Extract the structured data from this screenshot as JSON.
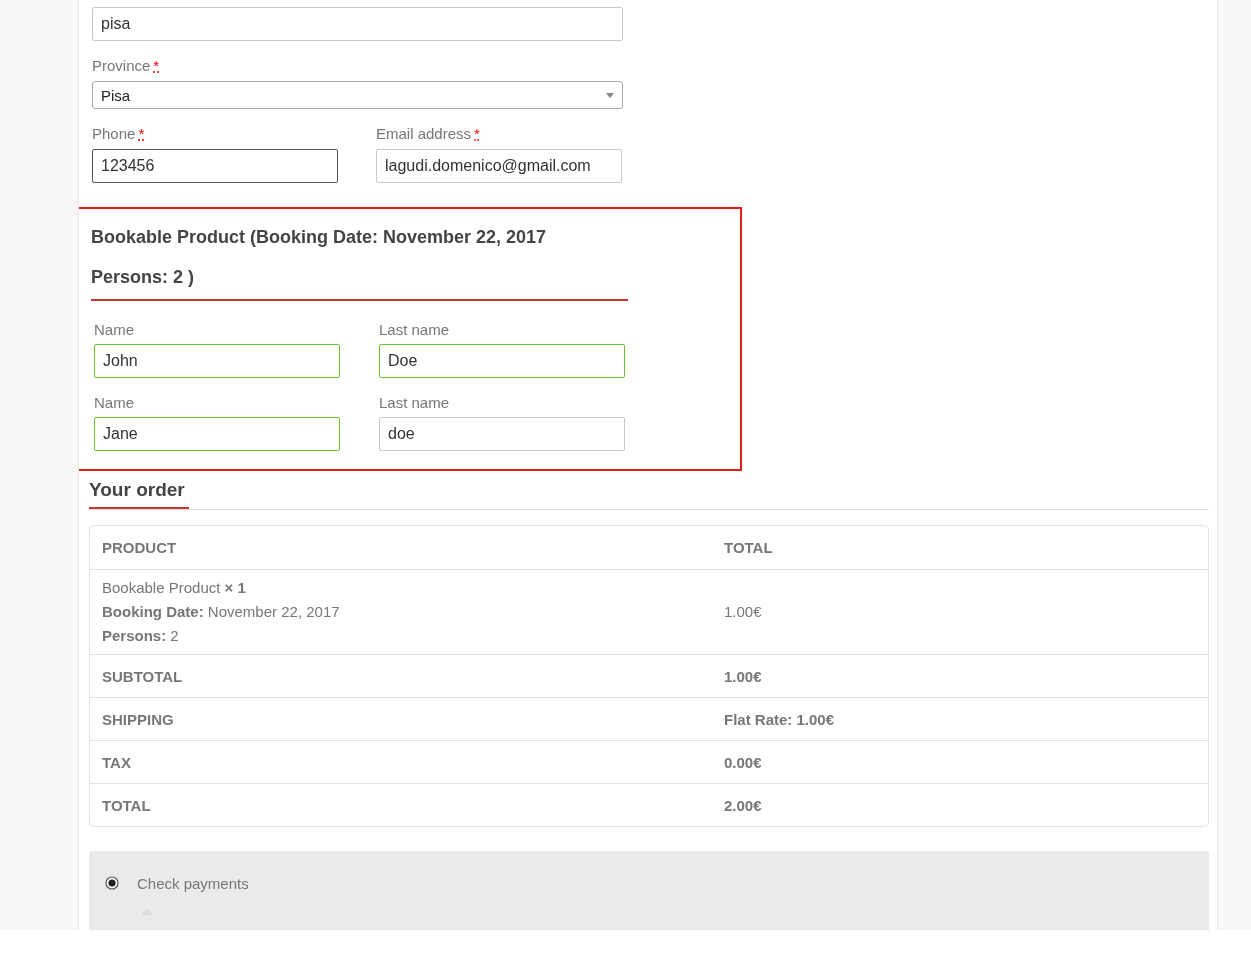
{
  "address_fields": [
    [
      {
        "kind": "text",
        "value": "pisa",
        "focused": false
      }
    ],
    [
      {
        "kind": "select",
        "label": {
          "text": "Province",
          "required_mark": "*"
        },
        "value": "Pisa"
      }
    ],
    [
      {
        "kind": "text",
        "label": {
          "text": "Phone",
          "required_mark": "*"
        },
        "value": "123456",
        "focused": true
      },
      {
        "kind": "text",
        "label": {
          "text": "Email address",
          "required_mark": "*"
        },
        "value": "lagudi.domenico@gmail.com",
        "focused": false
      }
    ]
  ],
  "participants": {
    "highlighted": true,
    "heading": "Bookable Product (Booking Date: November 22, 2017 Persons: 2 )",
    "fields": [
      {
        "label": "Name",
        "value": "John",
        "valid": true
      },
      {
        "label": "Last name",
        "value": "Doe",
        "valid": true
      },
      {
        "label": "Name",
        "value": "Jane",
        "valid": true
      },
      {
        "label": "Last name",
        "value": "doe",
        "valid": false
      }
    ]
  },
  "order": {
    "heading": "Your order",
    "columns": [
      "PRODUCT",
      "TOTAL"
    ],
    "items": [
      {
        "name": "Bookable Product",
        "quantity": "× 1",
        "meta": [
          {
            "label": "Booking Date:",
            "value": "November 22, 2017"
          },
          {
            "label": "Persons:",
            "value": "2"
          }
        ],
        "total": "1.00€"
      }
    ],
    "totals": [
      {
        "label": "SUBTOTAL",
        "value": "1.00€"
      },
      {
        "label": "SHIPPING",
        "value": "Flat Rate: 1.00€"
      },
      {
        "label": "TAX",
        "value": "0.00€"
      },
      {
        "label": "TOTAL",
        "value": "2.00€"
      }
    ]
  },
  "payment_methods": [
    {
      "label": "Check payments",
      "selected": true
    }
  ]
}
